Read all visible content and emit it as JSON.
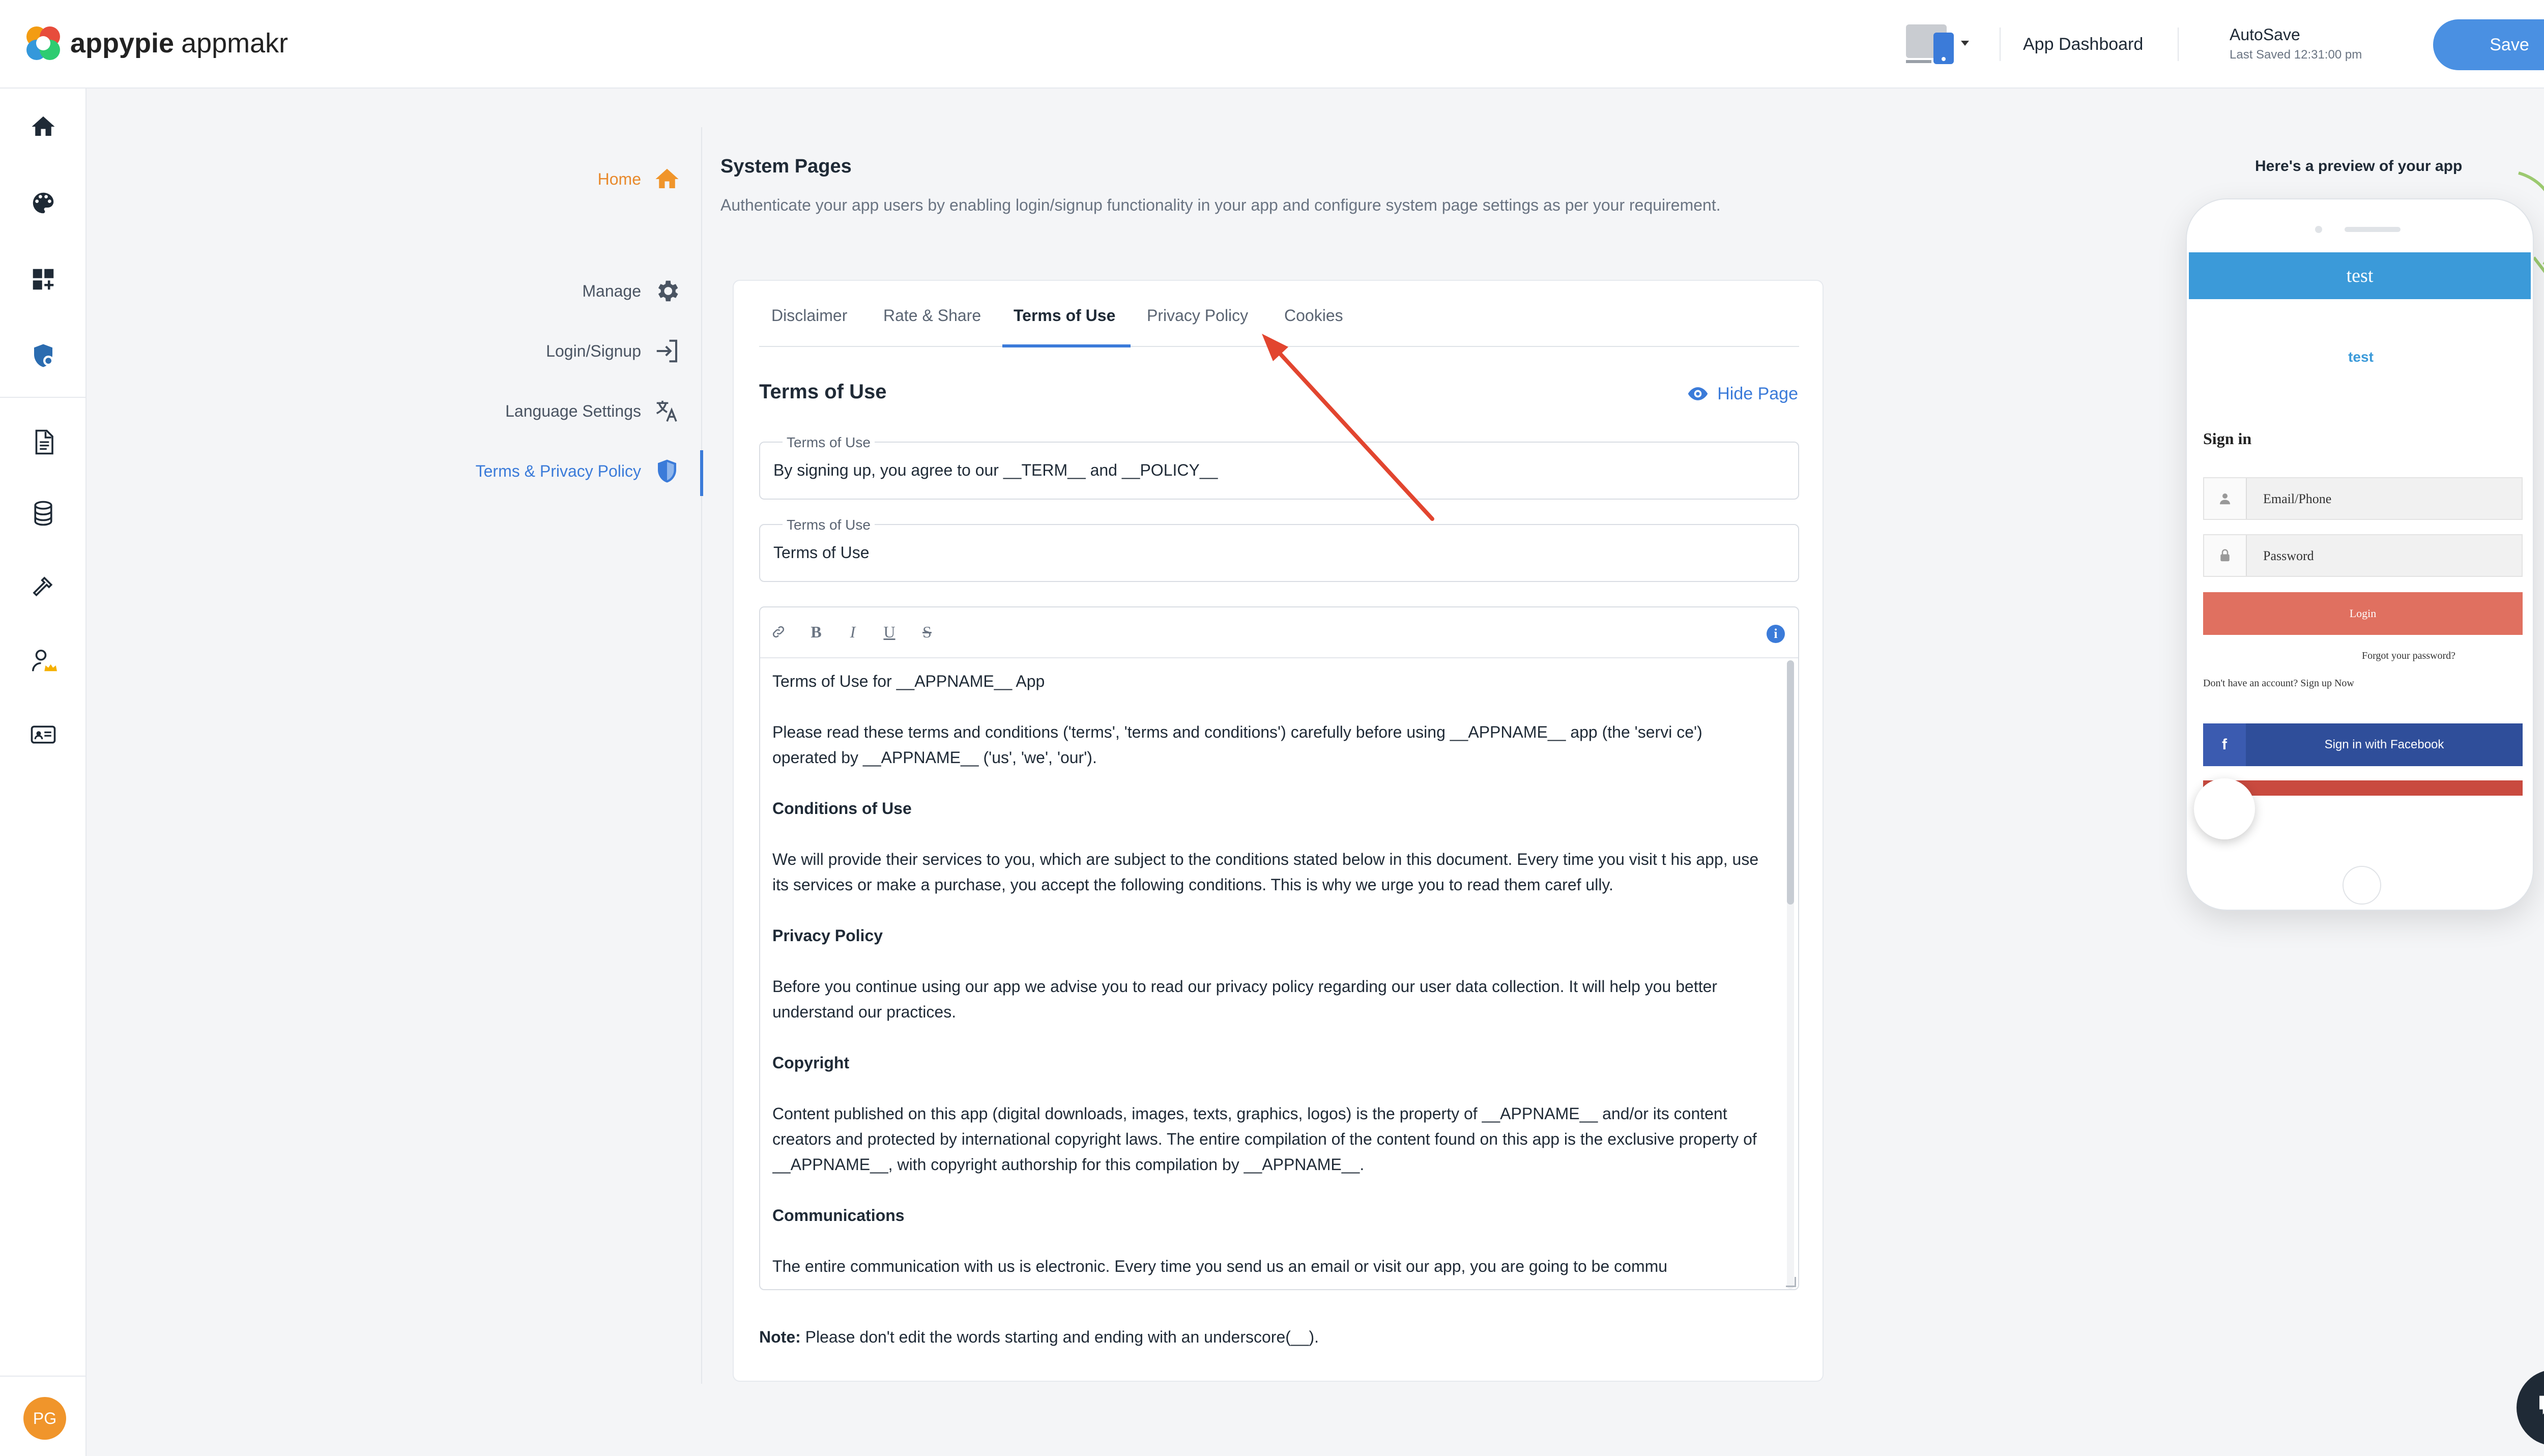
{
  "brand": {
    "logo": "appypie",
    "product": "appmakr",
    "logo_colors": [
      "#e74c3c",
      "#f39c12",
      "#3498db",
      "#2ecc71"
    ]
  },
  "header": {
    "app_dashboard": "App Dashboard",
    "autosave_title": "AutoSave",
    "autosave_status": "Last Saved 12:31:00 pm",
    "save_label": "Save",
    "accent": "#4a90e2"
  },
  "sidebar": {
    "icons": [
      "home-icon",
      "palette-icon",
      "dashboard-add-icon",
      "shield-settings-icon",
      "document-icon",
      "database-icon",
      "hammer-icon",
      "premium-user-icon",
      "id-card-icon"
    ],
    "avatar": "PG"
  },
  "subnav": {
    "home": "Home",
    "items": [
      {
        "label": "Manage",
        "icon": "gear-icon"
      },
      {
        "label": "Login/Signup",
        "icon": "login-icon"
      },
      {
        "label": "Language Settings",
        "icon": "translate-icon"
      },
      {
        "label": "Terms & Privacy Policy",
        "icon": "shield-icon",
        "active": true
      }
    ]
  },
  "page": {
    "title": "System Pages",
    "description": "Authenticate your app users by enabling login/signup functionality in your app and configure system page settings as per your requirement."
  },
  "tabs": [
    {
      "label": "Disclaimer"
    },
    {
      "label": "Rate & Share"
    },
    {
      "label": "Terms of Use",
      "active": true
    },
    {
      "label": "Privacy Policy"
    },
    {
      "label": "Cookies"
    }
  ],
  "section": {
    "title": "Terms of Use",
    "hide_label": "Hide Page",
    "field1": {
      "label": "Terms of Use",
      "value": "By signing up, you agree to our __TERM__ and __POLICY__"
    },
    "field2": {
      "label": "Terms of Use",
      "value": "Terms of Use"
    }
  },
  "editor": {
    "tools": [
      "link-icon",
      "B",
      "I",
      "U",
      "S"
    ],
    "content": [
      {
        "type": "p",
        "text": "Terms of Use for __APPNAME__ App"
      },
      {
        "type": "p",
        "text": "Please read these terms and conditions ('terms', 'terms and conditions') carefully before using __APPNAME__ app (the 'servi ce') operated by __APPNAME__ ('us', 'we', 'our')."
      },
      {
        "type": "h",
        "text": "Conditions of Use"
      },
      {
        "type": "p",
        "text": "We will provide their services to you, which are subject to the conditions stated below in this document. Every time you visit t his app, use its services or make a purchase, you accept the following conditions. This is why we urge you to read them caref ully."
      },
      {
        "type": "h",
        "text": "Privacy Policy"
      },
      {
        "type": "p",
        "text": "Before you continue using our app we advise you to read our privacy policy regarding our user data collection. It will help you better understand our practices."
      },
      {
        "type": "h",
        "text": "Copyright"
      },
      {
        "type": "p",
        "text": "Content published on this app (digital downloads, images, texts, graphics, logos) is the property of __APPNAME__ and/or its content creators and protected by international copyright laws. The entire compilation of the content found on this app is the exclusive property of __APPNAME__, with copyright authorship for this compilation by __APPNAME__."
      },
      {
        "type": "h",
        "text": "Communications"
      },
      {
        "type": "p",
        "text": "The entire communication with us is electronic. Every time you send us an email or visit our app, you are going to be commu"
      }
    ]
  },
  "note": {
    "bold": "Note:",
    "text": " Please don't edit the words starting and ending with an underscore(__)."
  },
  "preview": {
    "caption": "Here's a preview of your app",
    "app_title": "test",
    "logo_text": "test",
    "signin_heading": "Sign in",
    "email_placeholder": "Email/Phone",
    "password_placeholder": "Password",
    "login_label": "Login",
    "forgot": "Forgot your password?",
    "signup": "Don't have an account? Sign up Now",
    "facebook": "Sign in with Facebook",
    "colors": {
      "bar": "#3b9ad9",
      "login": "#e07060",
      "facebook": "#2f4e9a"
    }
  }
}
